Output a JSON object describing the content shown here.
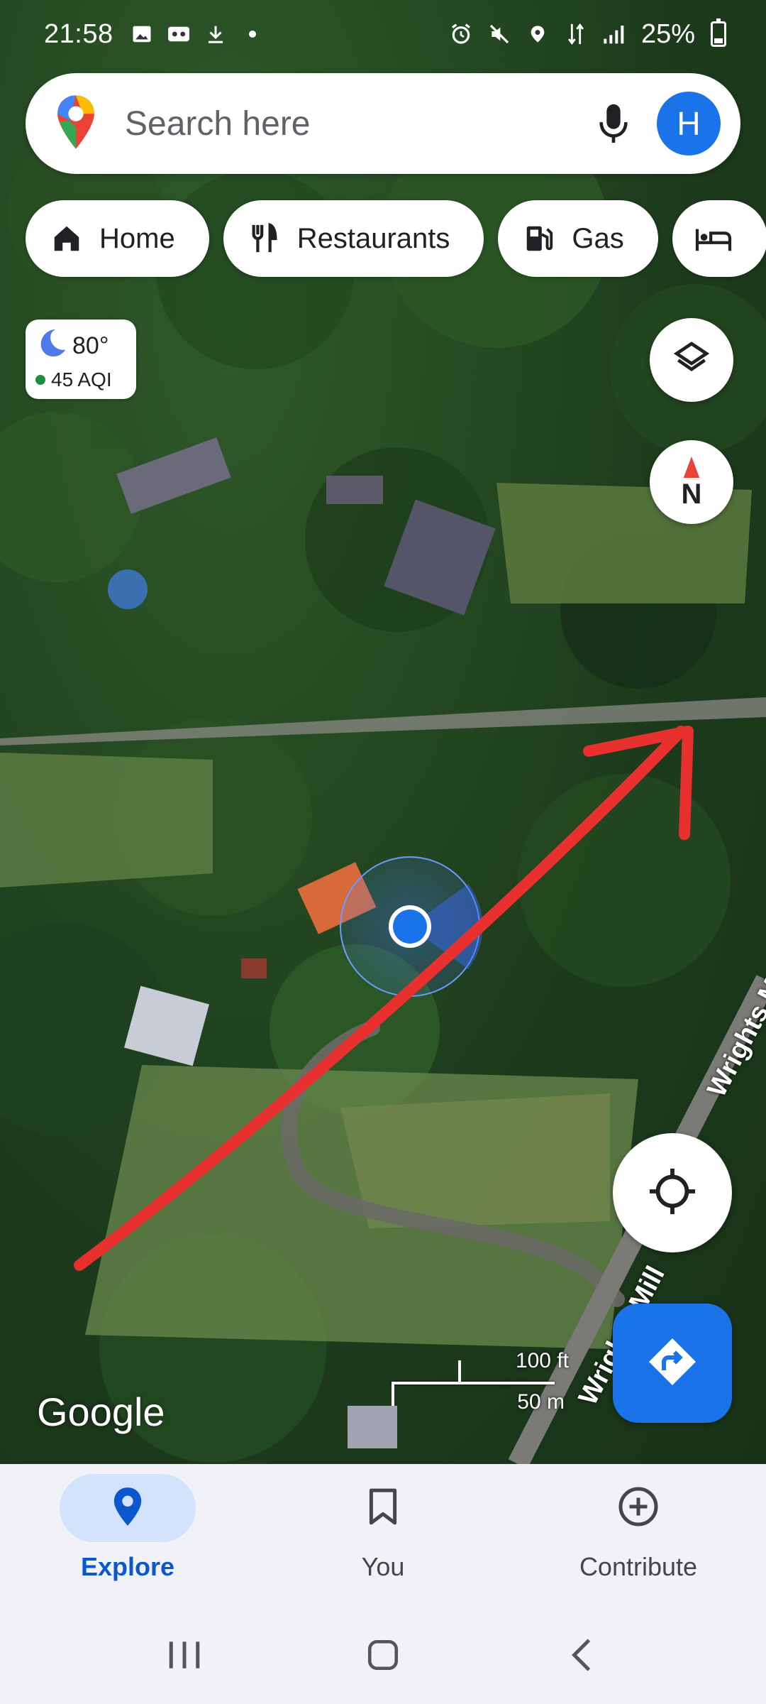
{
  "status_bar": {
    "time": "21:58",
    "battery": "25%",
    "icons": [
      "gallery-icon",
      "voicemail-icon",
      "download-icon",
      "dot-icon",
      "alarm-icon",
      "mute-icon",
      "location-icon",
      "data-icon",
      "signal-icon",
      "battery-icon"
    ]
  },
  "search": {
    "placeholder": "Search here",
    "avatar_initial": "H"
  },
  "chips": [
    {
      "label": "Home",
      "icon": "home-icon"
    },
    {
      "label": "Restaurants",
      "icon": "restaurant-icon"
    },
    {
      "label": "Gas",
      "icon": "gas-station-icon"
    },
    {
      "label": "",
      "icon": "hotel-icon"
    }
  ],
  "weather": {
    "temp": "80°",
    "aqi": "45 AQI"
  },
  "map": {
    "compass_label": "N",
    "scale_ft": "100 ft",
    "scale_m": "50 m",
    "road_label": "Wrights Mill",
    "road_label_2": "Wrights M",
    "attribution": "Google",
    "colors": {
      "annotation": "#e8302f",
      "location_dot": "#1a73e8"
    }
  },
  "bottom_nav": [
    {
      "label": "Explore",
      "icon": "explore-pin-icon",
      "active": true
    },
    {
      "label": "You",
      "icon": "bookmark-icon",
      "active": false
    },
    {
      "label": "Contribute",
      "icon": "add-circle-icon",
      "active": false
    }
  ]
}
